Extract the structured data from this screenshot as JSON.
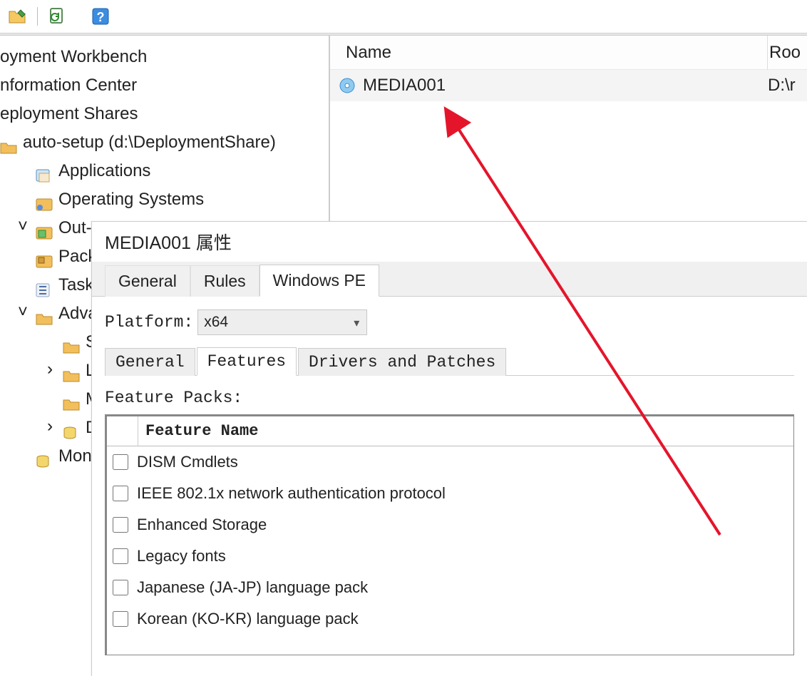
{
  "toolbar": {
    "icons": [
      "folder-open-icon",
      "refresh-sheet-icon",
      "help-icon"
    ]
  },
  "tree": {
    "root1": "oyment Workbench",
    "info_center": "nformation Center",
    "deployment_shares": "eployment Shares",
    "auto_setup": "auto-setup (d:\\DeploymentShare)",
    "items": [
      {
        "label": "Applications",
        "icon": "app"
      },
      {
        "label": "Operating Systems",
        "icon": "os"
      },
      {
        "label": "Out-o",
        "icon": "outd",
        "expander": "v"
      },
      {
        "label": "Packa",
        "icon": "pkg"
      },
      {
        "label": "Task",
        "icon": "task"
      },
      {
        "label": "Advan",
        "icon": "folder",
        "expander": "v"
      }
    ],
    "advanced_children": [
      {
        "label": "Se",
        "icon": "folder",
        "has_chev": false
      },
      {
        "label": "Lin",
        "icon": "folder",
        "has_chev": true
      },
      {
        "label": "M",
        "icon": "folder",
        "has_chev": false
      },
      {
        "label": "Da",
        "icon": "db",
        "has_chev": true
      }
    ],
    "monitor": "Monit"
  },
  "list": {
    "col_name": "Name",
    "col_root": "Roo",
    "row_name": "MEDIA001",
    "row_root": "D:\\r"
  },
  "dialog": {
    "title": "MEDIA001 属性",
    "tabs": {
      "general": "General",
      "rules": "Rules",
      "winpe": "Windows PE"
    },
    "platform_label": "Platform:",
    "platform_value": "x64",
    "subtabs": {
      "general": "General",
      "features": "Features",
      "drivers": "Drivers and Patches"
    },
    "feature_packs_label": "Feature Packs:",
    "feature_header": "Feature Name",
    "features": [
      "DISM Cmdlets",
      "IEEE 802.1x network authentication protocol",
      "Enhanced Storage",
      "Legacy fonts",
      "Japanese (JA-JP) language pack",
      "Korean (KO-KR) language pack"
    ]
  },
  "chart_data": null
}
